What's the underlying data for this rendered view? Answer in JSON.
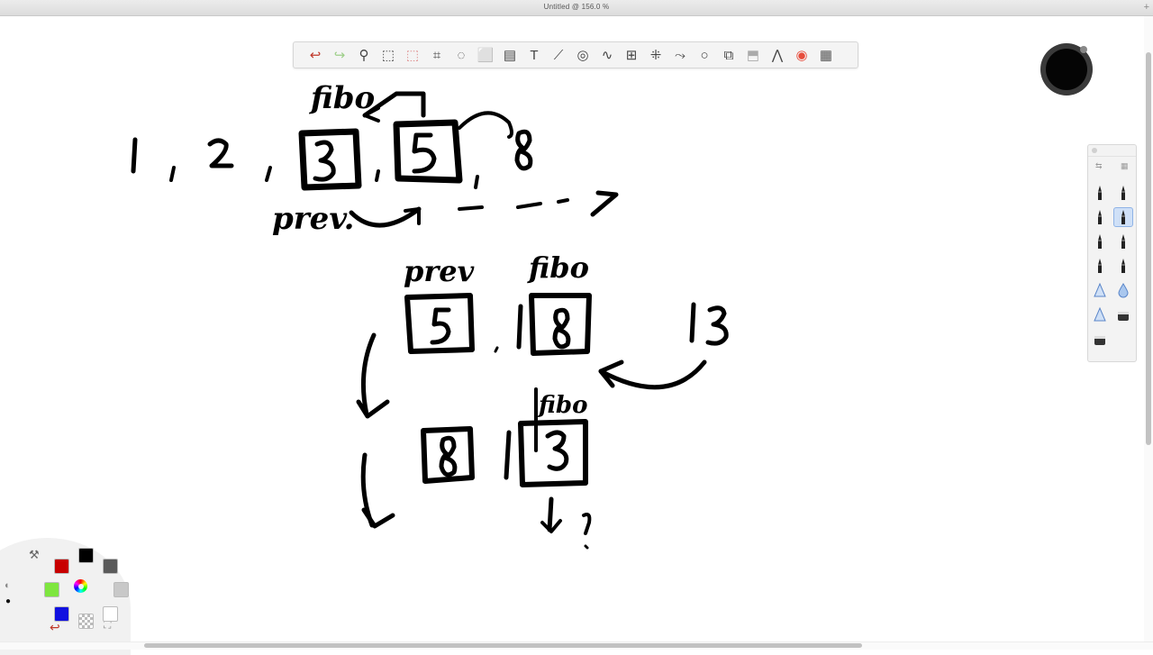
{
  "window": {
    "title": "Untitled @ 156.0 %",
    "new_tab": "+"
  },
  "toolbar": {
    "tools": [
      {
        "name": "undo-icon",
        "glyph": "↩",
        "color": "#c0392b"
      },
      {
        "name": "redo-icon",
        "glyph": "↪",
        "color": "#9ecf8a"
      },
      {
        "name": "zoom-icon",
        "glyph": "⚲",
        "color": "#444"
      },
      {
        "name": "selection-icon",
        "glyph": "⬚",
        "color": "#444"
      },
      {
        "name": "clear-selection-icon",
        "glyph": "⬚",
        "color": "#d88"
      },
      {
        "name": "crop-icon",
        "glyph": "⌗",
        "color": "#444"
      },
      {
        "name": "lasso-icon",
        "glyph": "◌",
        "color": "#444"
      },
      {
        "name": "transform-icon",
        "glyph": "⬜",
        "color": "#444"
      },
      {
        "name": "layers-icon",
        "glyph": "▤",
        "color": "#444"
      },
      {
        "name": "text-icon",
        "glyph": "T",
        "color": "#444"
      },
      {
        "name": "ruler-icon",
        "glyph": "⟋",
        "color": "#444"
      },
      {
        "name": "ellipse-guide-icon",
        "glyph": "◎",
        "color": "#444"
      },
      {
        "name": "curve-guide-icon",
        "glyph": "∿",
        "color": "#444"
      },
      {
        "name": "perspective-icon",
        "glyph": "⊞",
        "color": "#444"
      },
      {
        "name": "symmetry-icon",
        "glyph": "⁜",
        "color": "#444"
      },
      {
        "name": "steady-stroke-icon",
        "glyph": "⤳",
        "color": "#444"
      },
      {
        "name": "shape-icon",
        "glyph": "○",
        "color": "#444"
      },
      {
        "name": "fill-icon",
        "glyph": "⧉",
        "color": "#444"
      },
      {
        "name": "flood-fill-icon",
        "glyph": "⬒",
        "color": "#aaa"
      },
      {
        "name": "brush-library-icon",
        "glyph": "⋀",
        "color": "#444"
      },
      {
        "name": "color-wheel-icon",
        "glyph": "◉",
        "color": "#e74c3c"
      },
      {
        "name": "palette-grid-icon",
        "glyph": "▦",
        "color": "#555"
      }
    ]
  },
  "brush_panel": {
    "top_left_label": "⇆",
    "top_right_label": "▦",
    "brushes": [
      {
        "name": "pencil-brush-icon"
      },
      {
        "name": "felt-pen-brush-icon"
      },
      {
        "name": "ink-pen-brush-icon"
      },
      {
        "name": "calligraphy-brush-icon",
        "selected": true
      },
      {
        "name": "marker-brush-icon"
      },
      {
        "name": "thin-pencil-brush-icon"
      },
      {
        "name": "brush-pen-icon"
      },
      {
        "name": "fountain-pen-icon"
      },
      {
        "name": "airbrush-icon"
      },
      {
        "name": "blender-drop-icon"
      },
      {
        "name": "smudge-icon"
      },
      {
        "name": "eraser-soft-icon"
      },
      {
        "name": "eraser-icon"
      }
    ]
  },
  "colors": {
    "brush": "#000000",
    "swatches": [
      {
        "name": "red-swatch",
        "color": "#c80000"
      },
      {
        "name": "black-swatch",
        "color": "#000000"
      },
      {
        "name": "dark-gray-swatch",
        "color": "#5a5a5a"
      },
      {
        "name": "green-swatch",
        "color": "#7ee63f"
      },
      {
        "name": "light-gray-swatch",
        "color": "#c8c8c8"
      },
      {
        "name": "blue-swatch",
        "color": "#1010e0"
      },
      {
        "name": "white-swatch",
        "color": "#ffffff"
      }
    ]
  },
  "drawing": {
    "labels": {
      "fibo_top": "fibo",
      "seq_1": "1",
      "seq_2": "2",
      "seq_3": "3",
      "seq_5": "5",
      "seq_8": "8",
      "prev_left": "prev.",
      "prev_mid": "prev",
      "fibo_mid": "fibo",
      "box_5": "5",
      "box_8": "8",
      "num_13": "13",
      "fibo_low": "fibo",
      "box_8_low": "8",
      "box_13": "13"
    }
  }
}
